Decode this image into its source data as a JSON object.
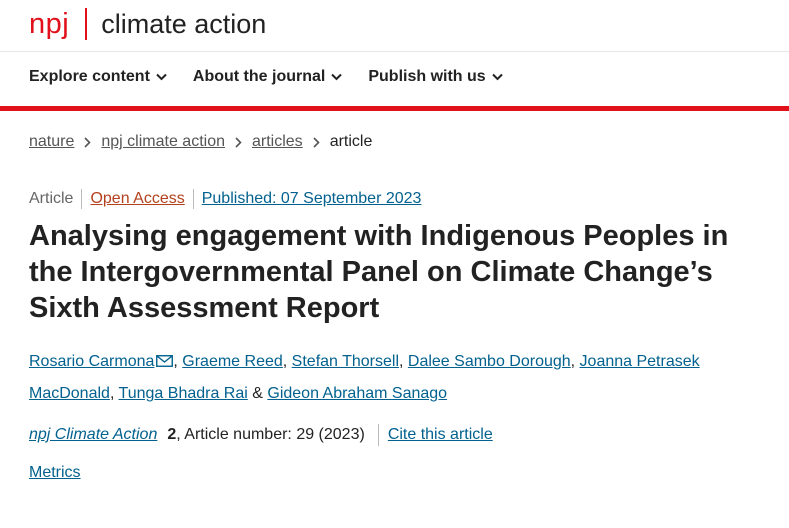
{
  "brand": {
    "logo": "npj",
    "journal": "climate action",
    "color": "#e0111b"
  },
  "nav": {
    "items": [
      {
        "label": "Explore content"
      },
      {
        "label": "About the journal"
      },
      {
        "label": "Publish with us"
      }
    ]
  },
  "breadcrumb": {
    "items": [
      "nature",
      "npj climate action",
      "articles"
    ],
    "current": "article"
  },
  "meta": {
    "type": "Article",
    "access": "Open Access",
    "published": "Published: 07 September 2023"
  },
  "title": "Analysing engagement with Indigenous Peoples in the Intergovernmental Panel on Climate Change’s Sixth Assessment Report",
  "authors": [
    "Rosario Carmona",
    "Graeme Reed",
    "Stefan Thorsell",
    "Dalee Sambo Dorough",
    "Joanna Petrasek MacDonald",
    "Tunga Bhadra Rai",
    "Gideon Abraham Sanago"
  ],
  "citation": {
    "journal": "npj Climate Action",
    "volume": "2",
    "rest": ", Article number: 29 (2023)",
    "cite_label": "Cite this article"
  },
  "metrics_label": "Metrics",
  "colors": {
    "accent": "#e0111b",
    "link": "#02618f",
    "open_access": "#b4411d"
  }
}
